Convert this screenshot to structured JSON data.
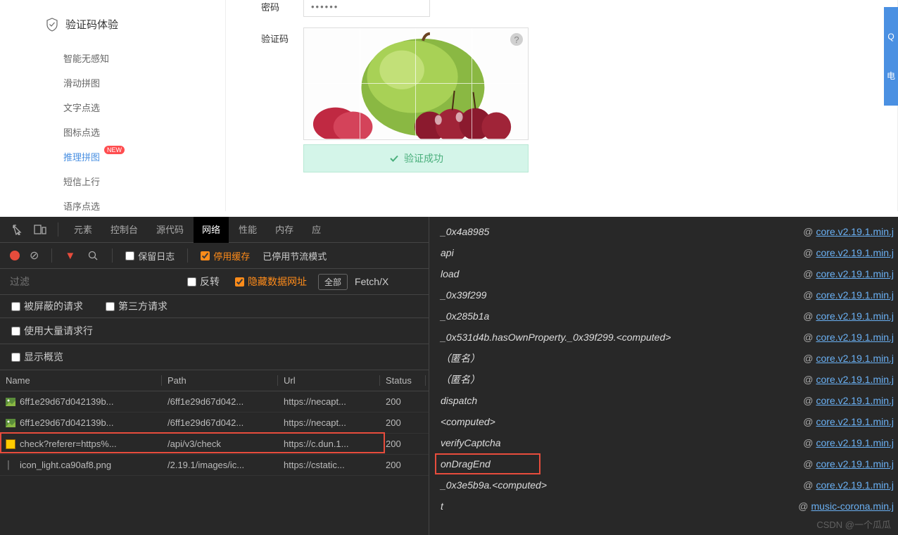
{
  "sidebar": {
    "title": "验证码体验",
    "items": [
      {
        "label": "智能无感知"
      },
      {
        "label": "滑动拼图"
      },
      {
        "label": "文字点选"
      },
      {
        "label": "图标点选"
      },
      {
        "label": "推理拼图",
        "active": true,
        "badge": "NEW"
      },
      {
        "label": "短信上行"
      },
      {
        "label": "语序点选"
      }
    ]
  },
  "form": {
    "password_label": "密码",
    "password_placeholder": "••••••",
    "captcha_label": "验证码",
    "success_text": "验证成功"
  },
  "right_tab": {
    "top": "Q",
    "bottom": "电"
  },
  "devtools": {
    "tabs": [
      "元素",
      "控制台",
      "源代码",
      "网络",
      "性能",
      "内存",
      "应"
    ],
    "active_tab": "网络",
    "toolbar": {
      "preserve_log": "保留日志",
      "disable_cache": "停用缓存",
      "throttle": "已停用节流模式"
    },
    "filter": {
      "placeholder": "过滤",
      "invert": "反转",
      "hide_data": "隐藏数据网址",
      "all": "全部",
      "fetch": "Fetch/X"
    },
    "checks": {
      "blocked": "被屏蔽的请求",
      "third_party": "第三方请求",
      "large_rows": "使用大量请求行",
      "overview": "显示概览"
    },
    "table": {
      "headers": {
        "name": "Name",
        "path": "Path",
        "url": "Url",
        "status": "Status"
      },
      "rows": [
        {
          "icon": "img",
          "name": "6ff1e29d67d042139b...",
          "path": "/6ff1e29d67d042...",
          "url": "https://necapt...",
          "status": "200"
        },
        {
          "icon": "img",
          "name": "6ff1e29d67d042139b...",
          "path": "/6ff1e29d67d042...",
          "url": "https://necapt...",
          "status": "200"
        },
        {
          "icon": "js",
          "name": "check?referer=https%...",
          "path": "/api/v3/check",
          "url": "https://c.dun.1...",
          "status": "200"
        },
        {
          "icon": "txt",
          "name": "icon_light.ca90af8.png",
          "path": "/2.19.1/images/ic...",
          "url": "https://cstatic...",
          "status": "200"
        }
      ]
    }
  },
  "stack": {
    "source": "core.v2.19.1.min.j",
    "music": "music-corona.min.j",
    "frames": [
      "_0x4a8985",
      "api",
      "load",
      "_0x39f299",
      "_0x285b1a",
      "_0x531d4b.hasOwnProperty._0x39f299.<computed>",
      "（匿名）",
      "（匿名）",
      "dispatch",
      "<computed>",
      "verifyCaptcha",
      "onDragEnd",
      "_0x3e5b9a.<computed>",
      "t"
    ]
  },
  "watermark": "CSDN @一个瓜瓜"
}
